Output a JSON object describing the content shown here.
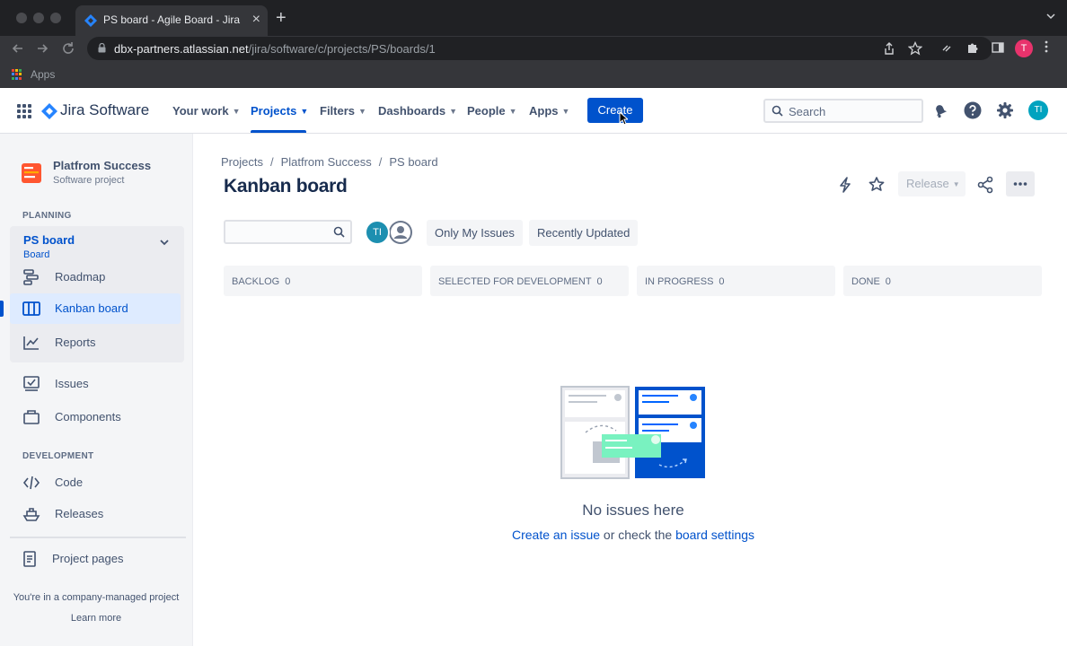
{
  "browser": {
    "tab_title": "PS board - Agile Board - Jira",
    "tab_close": "×",
    "new_tab": "+",
    "url_host": "dbx-partners.atlassian.net",
    "url_path": "/jira/software/c/projects/PS/boards/1",
    "profile_initial": "T",
    "bookmarks_apps": "Apps"
  },
  "topnav": {
    "logo": "Jira Software",
    "items": [
      "Your work",
      "Projects",
      "Filters",
      "Dashboards",
      "People",
      "Apps"
    ],
    "active_item": "Projects",
    "create_label": "Create",
    "search_placeholder": "Search",
    "user_initials": "TI"
  },
  "sidebar": {
    "project_name": "Platfrom Success",
    "project_type": "Software project",
    "planning_label": "PLANNING",
    "board_name": "PS board",
    "board_sub": "Board",
    "planning_items": [
      "Roadmap",
      "Kanban board",
      "Reports"
    ],
    "active_item": "Kanban board",
    "other_items": [
      "Issues",
      "Components"
    ],
    "development_label": "DEVELOPMENT",
    "development_items": [
      "Code",
      "Releases"
    ],
    "project_pages": "Project pages",
    "footer_text": "You're in a company-managed project",
    "footer_link": "Learn more"
  },
  "main": {
    "breadcrumbs": [
      "Projects",
      "Platfrom Success",
      "PS board"
    ],
    "breadcrumb_sep": "/",
    "title": "Kanban board",
    "release_label": "Release",
    "filter_avatar_initials": "TI",
    "quick_filters": [
      "Only My Issues",
      "Recently Updated"
    ],
    "columns": [
      {
        "name": "BACKLOG",
        "count": "0"
      },
      {
        "name": "SELECTED FOR DEVELOPMENT",
        "count": "0"
      },
      {
        "name": "IN PROGRESS",
        "count": "0"
      },
      {
        "name": "DONE",
        "count": "0"
      }
    ],
    "empty_title": "No issues here",
    "empty_link_create": "Create an issue",
    "empty_middle": " or check the ",
    "empty_link_settings": "board settings"
  },
  "colors": {
    "brand_blue": "#0052cc",
    "sidebar_bg": "#f4f5f7",
    "active_bg": "#deebff",
    "avatar_teal": "#00a3bf",
    "profile_pink": "#e8336c"
  }
}
